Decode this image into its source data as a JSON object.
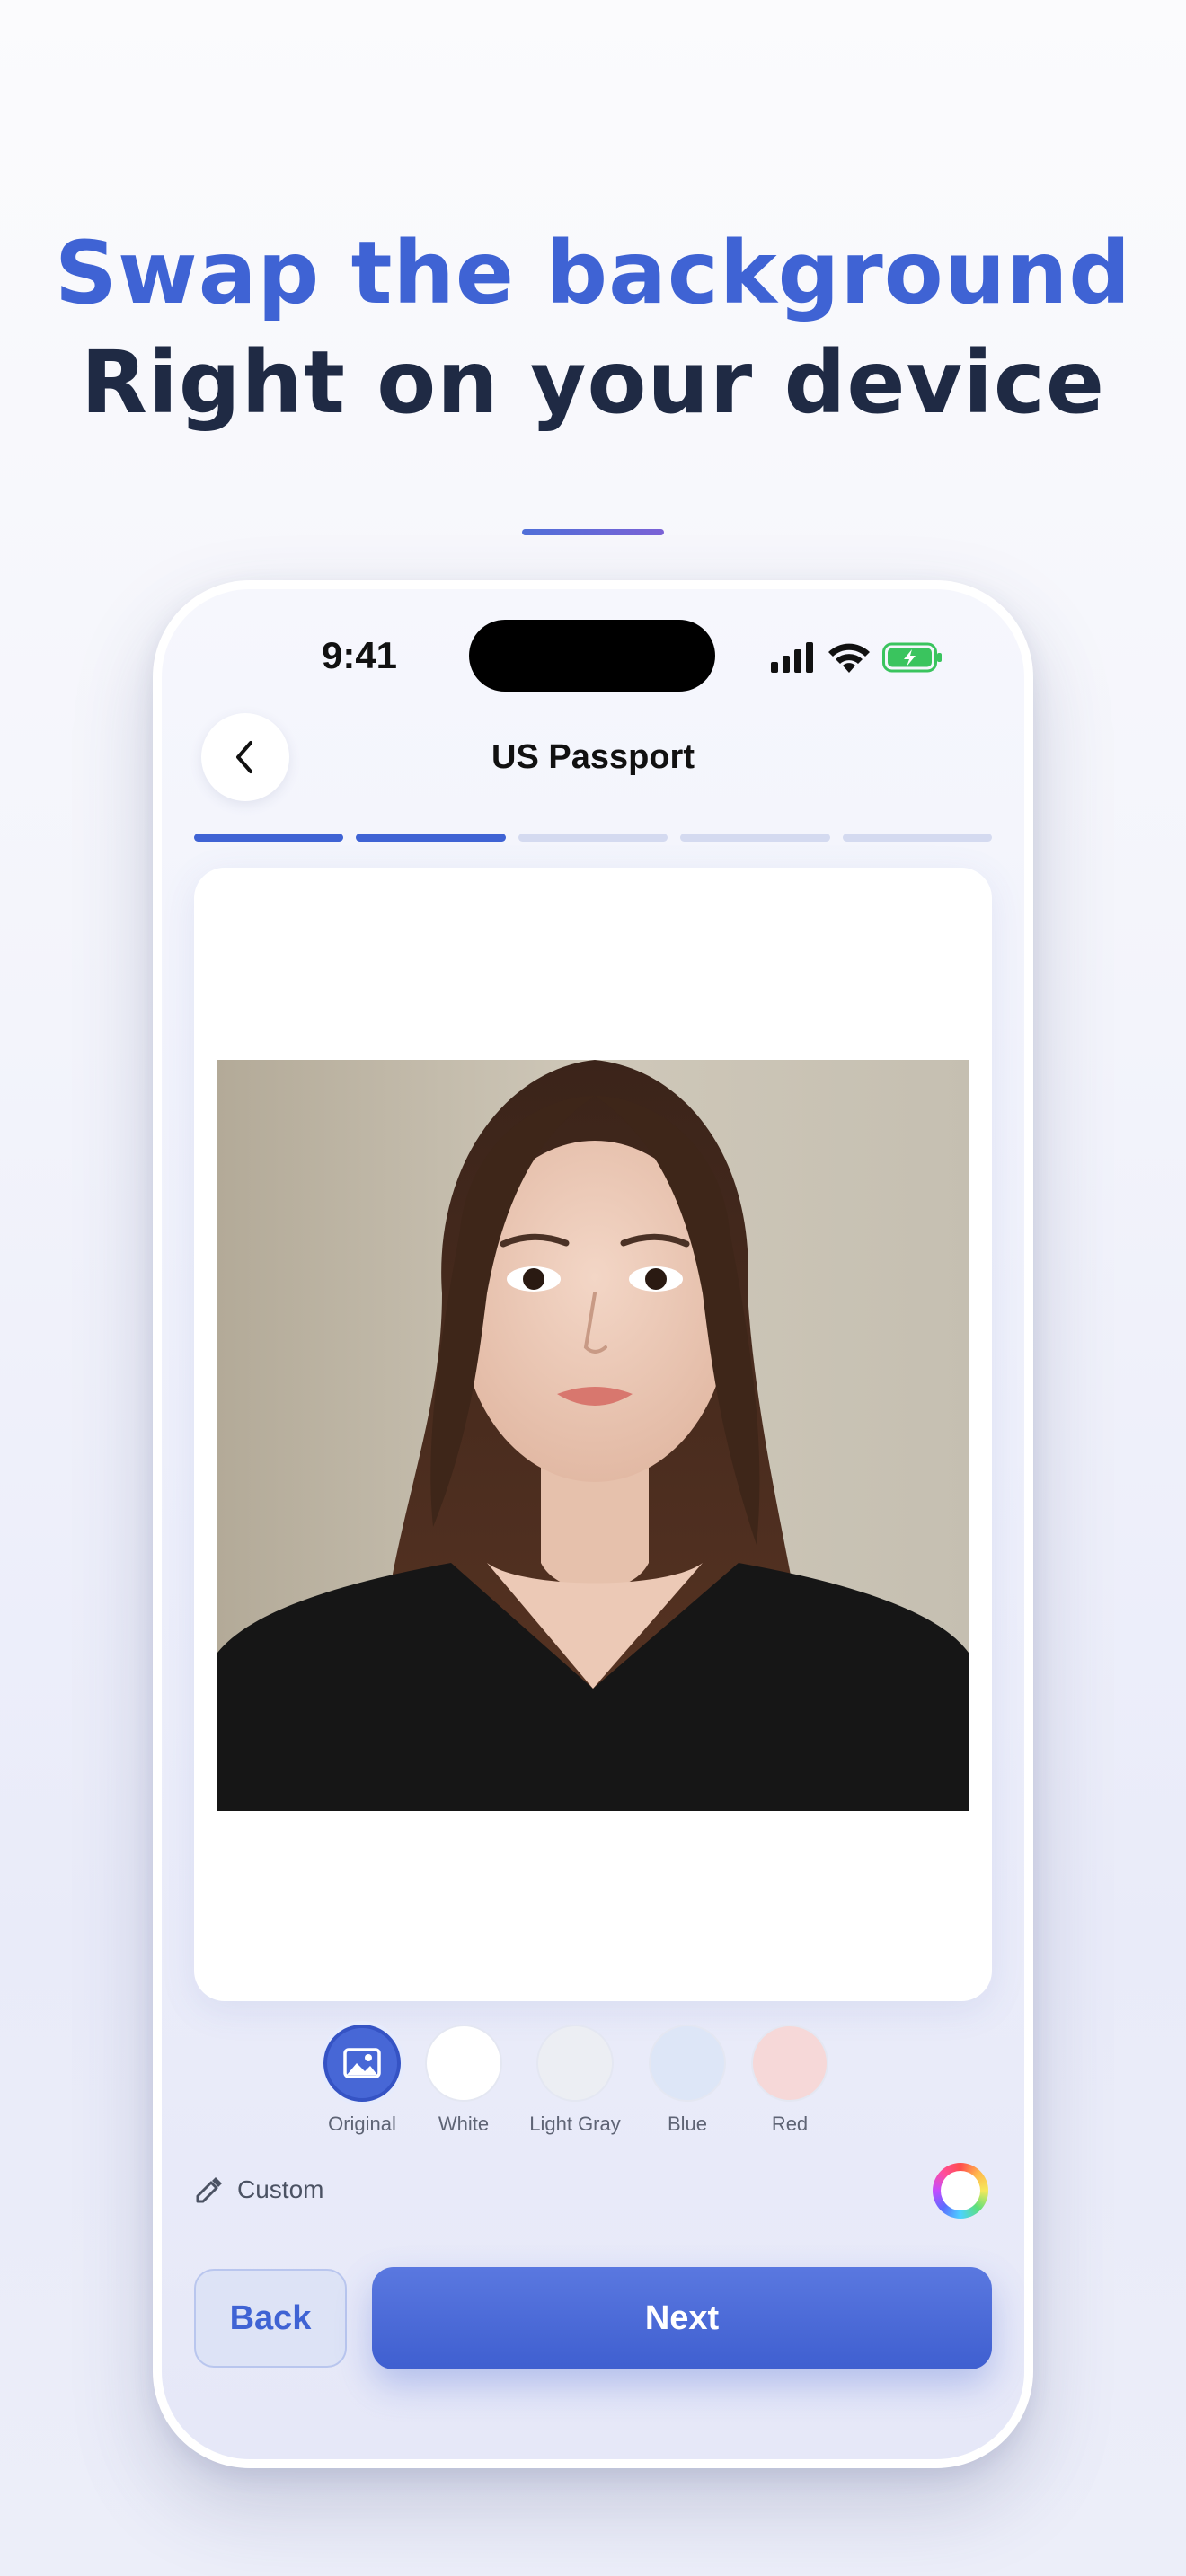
{
  "headline": {
    "line1": "Swap the background",
    "line2": "Right on your device"
  },
  "status_bar": {
    "time": "9:41"
  },
  "nav": {
    "title": "US Passport"
  },
  "steps": {
    "total": 5,
    "completed": 2
  },
  "background_options": [
    {
      "label": "Original",
      "color": "#4767d6",
      "selected": true,
      "icon": "image-icon"
    },
    {
      "label": "White",
      "color": "#ffffff",
      "selected": false
    },
    {
      "label": "Light Gray",
      "color": "#eceef3",
      "selected": false
    },
    {
      "label": "Blue",
      "color": "#dde6f7",
      "selected": false
    },
    {
      "label": "Red",
      "color": "#f6d8d8",
      "selected": false
    }
  ],
  "custom": {
    "label": "Custom"
  },
  "buttons": {
    "back": "Back",
    "next": "Next"
  },
  "colors": {
    "accent": "#3f63d4",
    "headline_dark": "#1f2a44"
  }
}
